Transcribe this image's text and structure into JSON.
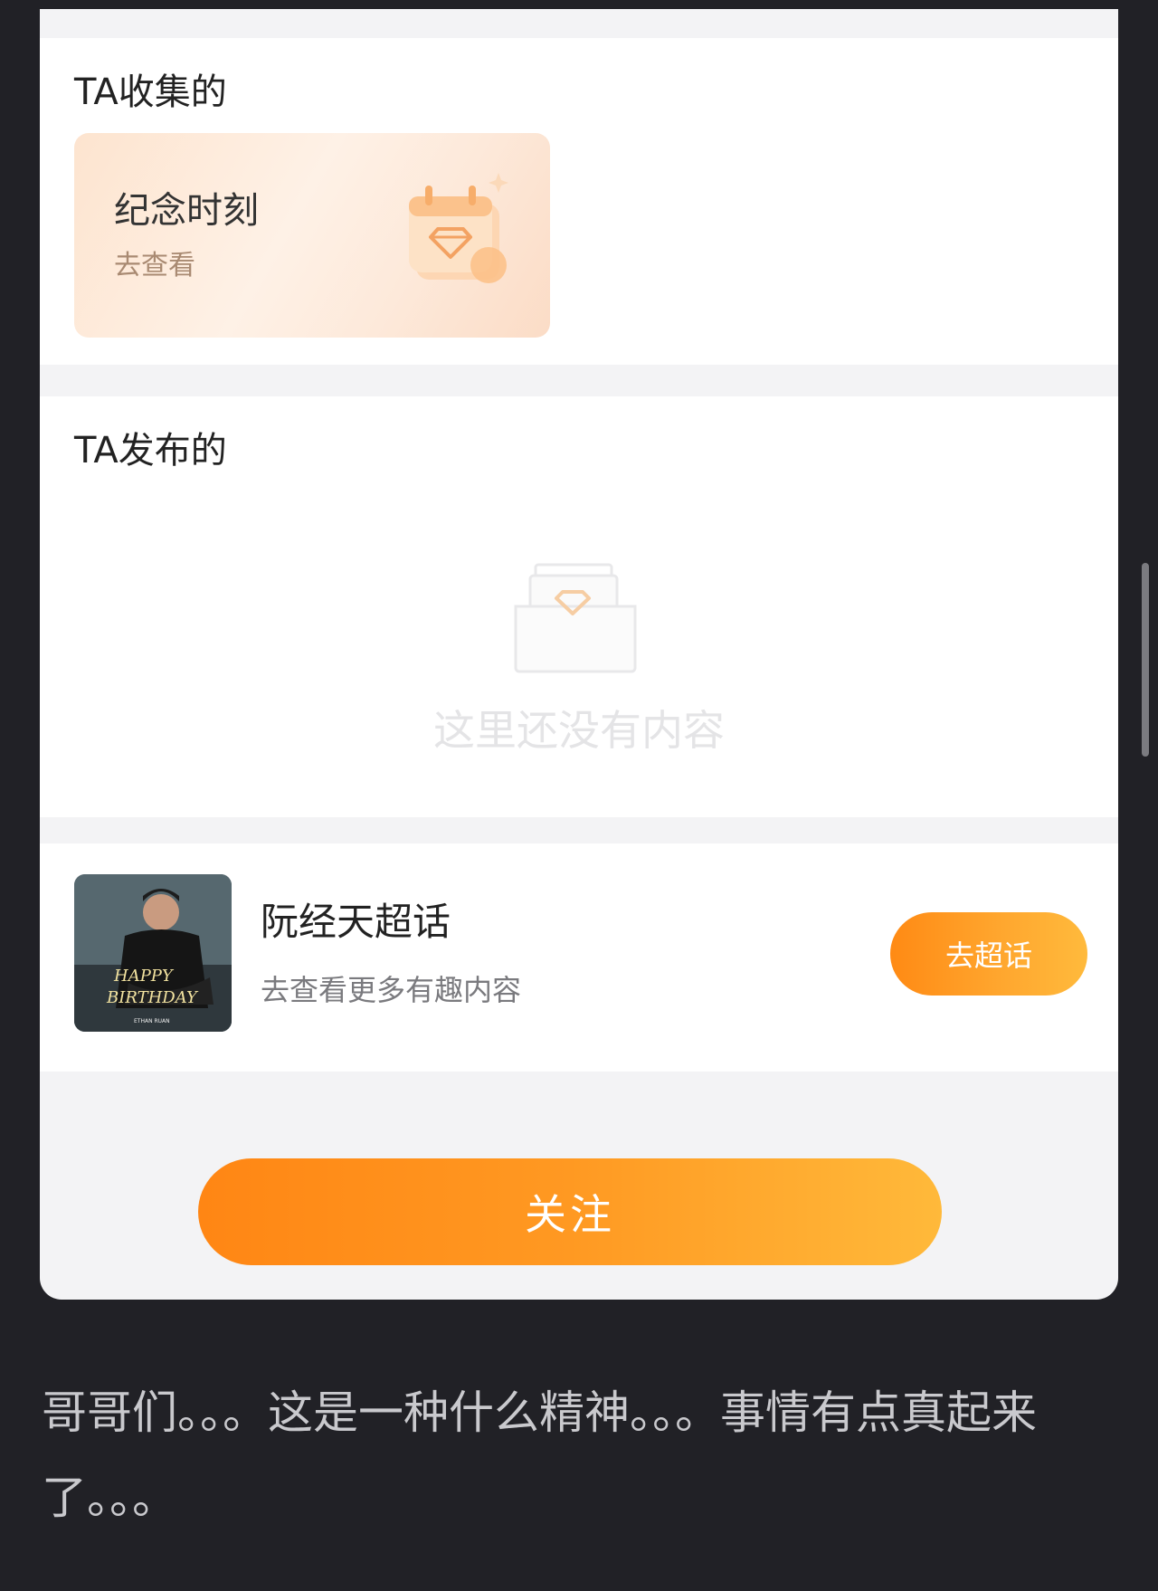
{
  "collected": {
    "title": "TA收集的",
    "card_title": "纪念时刻",
    "card_link": "去查看",
    "card_icon": "calendar-diamond-icon"
  },
  "posted": {
    "title": "TA发布的",
    "empty_text": "这里还没有内容",
    "empty_icon": "empty-box-diamond-icon"
  },
  "supertopic": {
    "name": "阮经天超话",
    "subtitle": "去查看更多有趣内容",
    "button_label": "去超话",
    "avatar_overlay": [
      "HAPPY",
      "BIRTHDAY",
      "ETHAN RUAN"
    ]
  },
  "follow_label": "关注",
  "caption": "哥哥们。。。这是一种什么精神。。。事情有点真起来了。。。",
  "colors": {
    "accent_orange": "#ff9a22",
    "background": "#212126"
  }
}
